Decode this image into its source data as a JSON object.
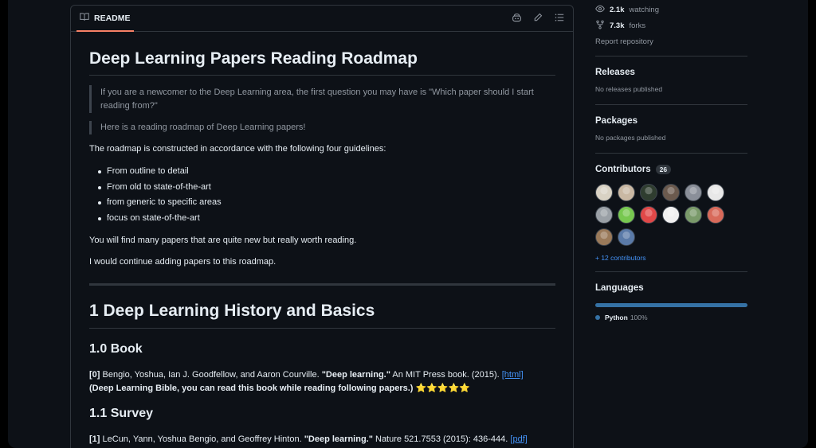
{
  "readme": {
    "tab_label": "README",
    "title": "Deep Learning Papers Reading Roadmap",
    "quote1": "If you are a newcomer to the Deep Learning area, the first question you may have is \"Which paper should I start reading from?\"",
    "quote2": "Here is a reading roadmap of Deep Learning papers!",
    "intro": "The roadmap is constructed in accordance with the following four guidelines:",
    "guidelines": [
      "From outline to detail",
      "From old to state-of-the-art",
      "from generic to specific areas",
      "focus on state-of-the-art"
    ],
    "para1": "You will find many papers that are quite new but really worth reading.",
    "para2": "I would continue adding papers to this roadmap.",
    "section1": "1 Deep Learning History and Basics",
    "sub_book": "1.0 Book",
    "ref0": {
      "num": "[0]",
      "authors": " Bengio, Yoshua, Ian J. Goodfellow, and Aaron Courville. ",
      "title": "\"Deep learning.\"",
      "venue": " An MIT Press book. (2015). ",
      "link": "[html]",
      "note": "(Deep Learning Bible, you can read this book while reading following papers.)",
      "stars": " ⭐⭐⭐⭐⭐"
    },
    "sub_survey": "1.1 Survey",
    "ref1": {
      "num": "[1]",
      "authors": " LeCun, Yann, Yoshua Bengio, and Geoffrey Hinton. ",
      "title": "\"Deep learning.\"",
      "venue": " Nature 521.7553 (2015): 436-444. ",
      "link": "[pdf]"
    }
  },
  "sidebar": {
    "watching_count": "2.1k",
    "watching_label": "watching",
    "forks_count": "7.3k",
    "forks_label": "forks",
    "report": "Report repository",
    "releases_title": "Releases",
    "releases_text": "No releases published",
    "packages_title": "Packages",
    "packages_text": "No packages published",
    "contributors_title": "Contributors",
    "contributors_count": "26",
    "contributors_more": "+ 12 contributors",
    "languages_title": "Languages",
    "language_name": "Python",
    "language_pct": "100%",
    "language_color": "#3572A5"
  },
  "avatar_colors": [
    "#d9d2c4",
    "#c9b8a3",
    "#2f3d2f",
    "#6b5a4e",
    "#8a8f99",
    "#e8e8e8",
    "#9aa0a6",
    "#78c850",
    "#e04848",
    "#f0f0f0",
    "#7a9a6a",
    "#d86a5a",
    "#9a7a5a",
    "#5a7aa8"
  ]
}
